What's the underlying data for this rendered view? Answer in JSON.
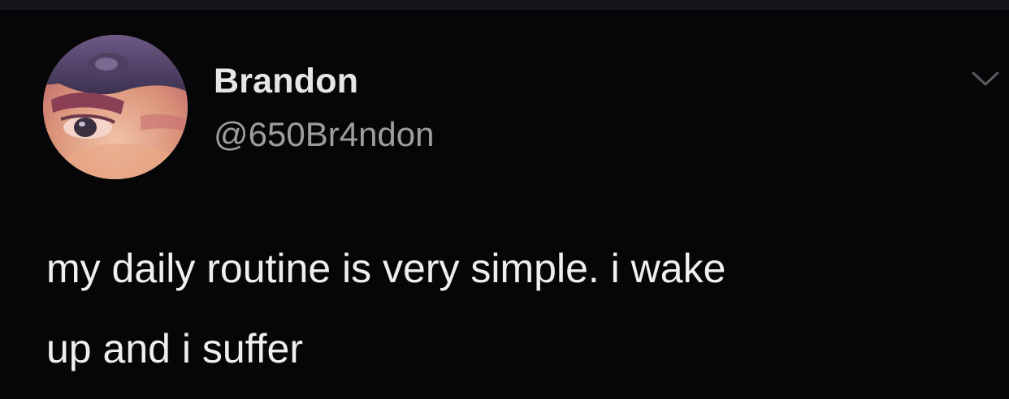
{
  "colors": {
    "background": "#060608",
    "top_strip": "#15161b",
    "name_text": "#e6e6e6",
    "handle_text": "#9d9d9d",
    "body_text": "#efefef",
    "chevron": "#5a5a5e"
  },
  "tweet": {
    "avatar_icon": "profile-photo",
    "display_name": "Brandon",
    "handle": "@650Br4ndon",
    "more_icon": "chevron-down-icon",
    "text_lines": [
      "my daily routine is very simple. i wake",
      "up and i suffer"
    ]
  }
}
